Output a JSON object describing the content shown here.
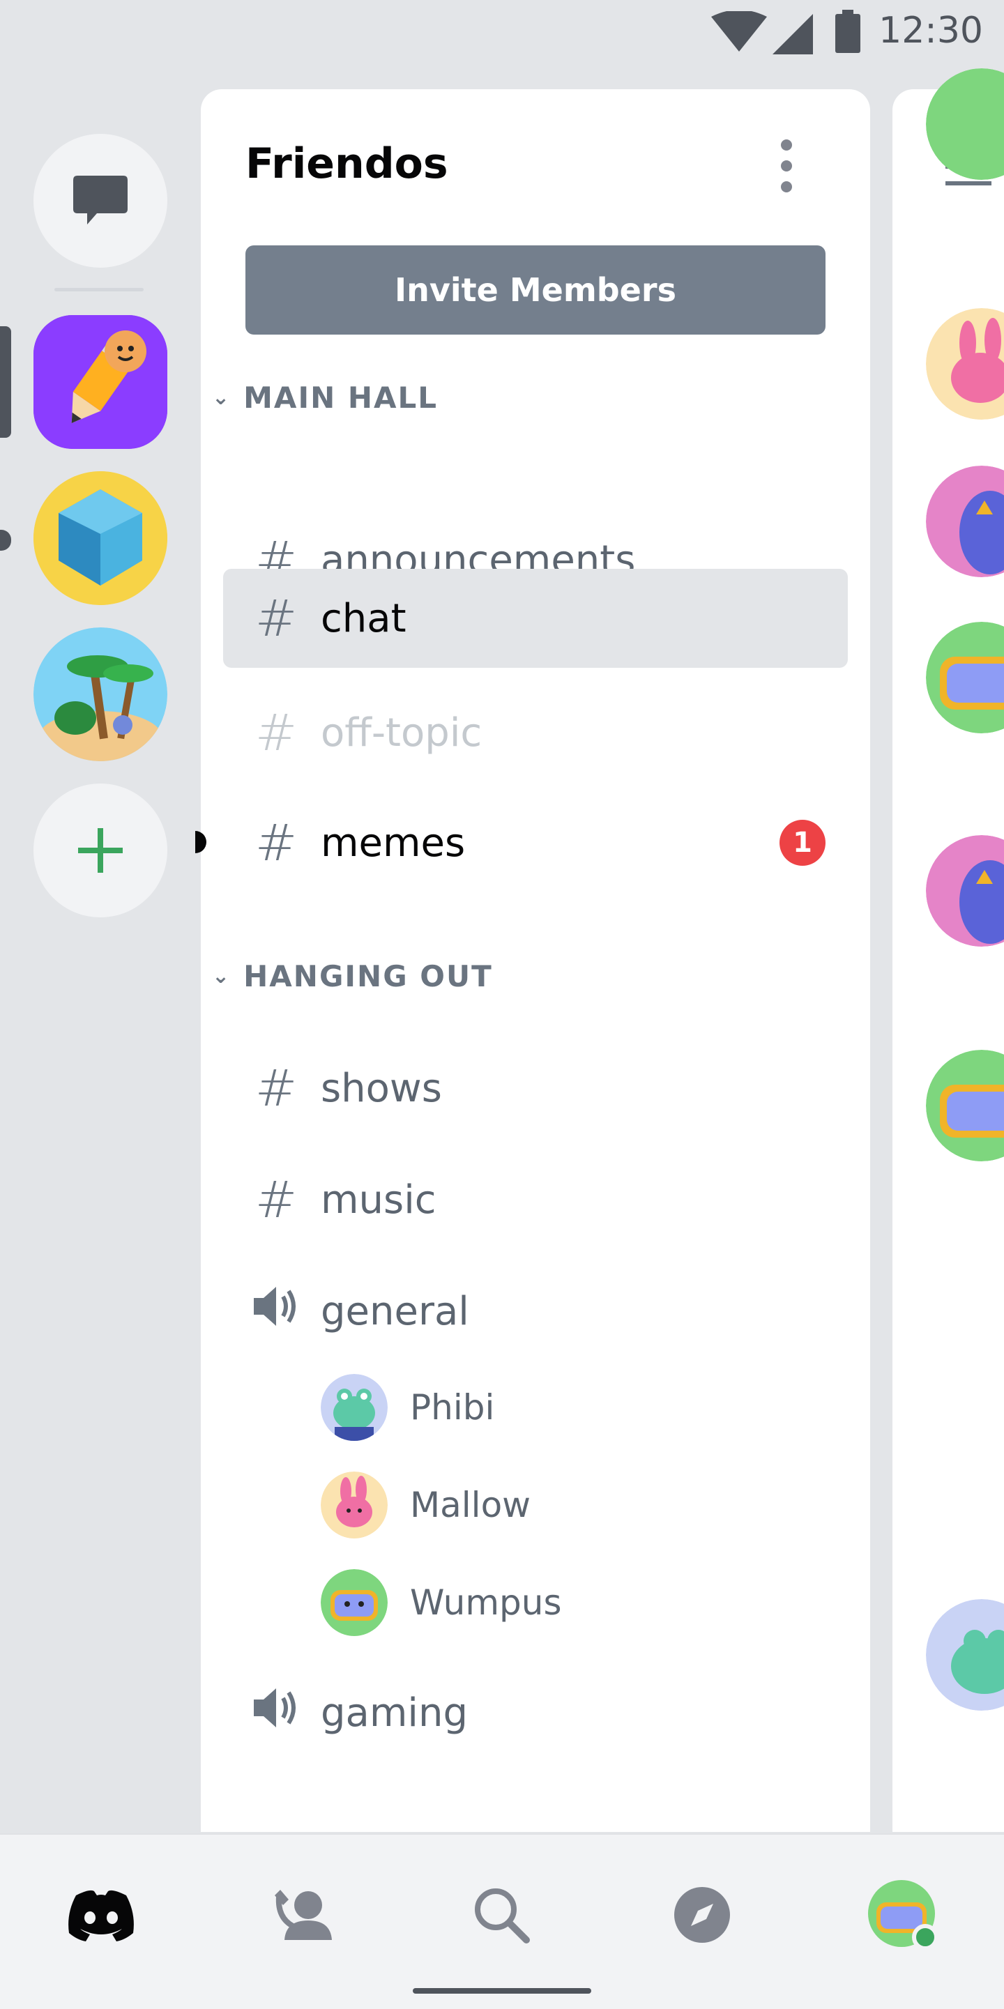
{
  "status_bar": {
    "time": "12:30"
  },
  "guild": {
    "name": "Friendos",
    "invite_label": "Invite Members"
  },
  "categories": [
    {
      "name": "MAIN HALL",
      "channels": [
        {
          "name": "announcements",
          "type": "text",
          "state": "normal"
        },
        {
          "name": "chat",
          "type": "text",
          "state": "selected"
        },
        {
          "name": "off-topic",
          "type": "text",
          "state": "muted"
        },
        {
          "name": "memes",
          "type": "text",
          "state": "unread",
          "mentions": "1"
        }
      ]
    },
    {
      "name": "HANGING OUT",
      "channels": [
        {
          "name": "shows",
          "type": "text"
        },
        {
          "name": "music",
          "type": "text"
        },
        {
          "name": "general",
          "type": "voice",
          "users": [
            "Phibi",
            "Mallow",
            "Wumpus"
          ]
        },
        {
          "name": "gaming",
          "type": "voice"
        }
      ]
    }
  ],
  "colors": {
    "accent": "#5865f2",
    "add_server": "#3ba55d",
    "mention_badge": "#ed4245",
    "online": "#3ba55d"
  },
  "icons": {
    "rail": [
      "chat-bubble-icon",
      "plus-icon"
    ],
    "bottom_nav": [
      "discord-home-icon",
      "friends-icon",
      "search-icon",
      "compass-icon",
      "profile-avatar"
    ],
    "top_right": "hamburger-menu-icon"
  }
}
